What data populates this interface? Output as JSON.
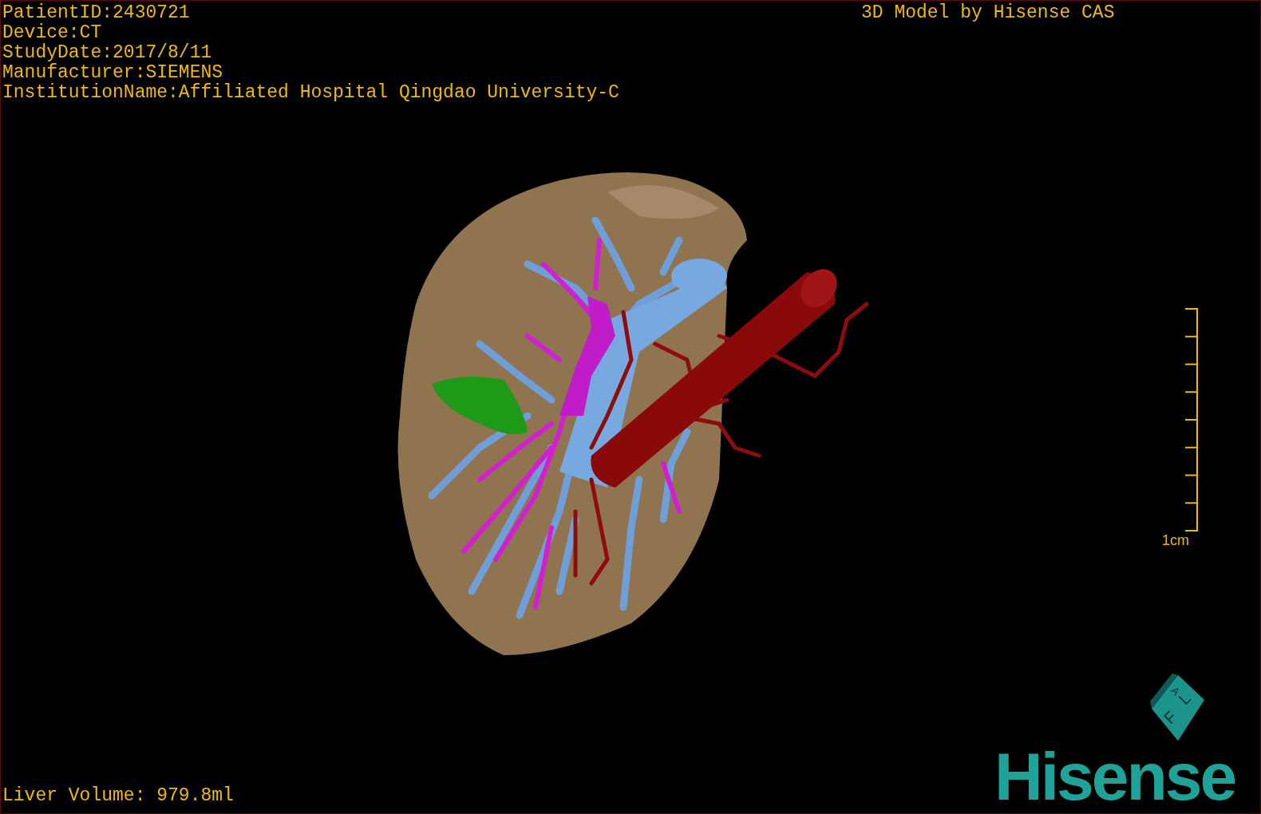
{
  "patient_info": [
    "PatientID:2430721",
    "Device:CT",
    "StudyDate:2017/8/11",
    "Manufacturer:SIEMENS",
    "InstitutionName:Affiliated Hospital Qingdao University-C"
  ],
  "title": "3D Model by Hisense CAS",
  "scale_bar": {
    "label": "1cm"
  },
  "liver_volume": "Liver Volume: 979.8ml",
  "orientation_cube": {
    "faces": [
      "A",
      "F",
      "L"
    ]
  },
  "logo": "Hisense"
}
